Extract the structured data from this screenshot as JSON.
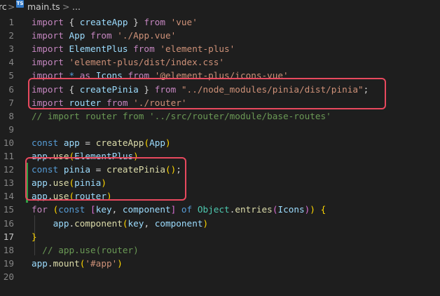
{
  "breadcrumb": {
    "prefix": "rc",
    "separator1": ">",
    "file_icon": "TS",
    "file": "main.ts",
    "separator2": ">",
    "more": "..."
  },
  "lines": [
    {
      "n": "1",
      "tokens": [
        [
          "k",
          "import"
        ],
        [
          "p",
          " { "
        ],
        [
          "v",
          "createApp"
        ],
        [
          "p",
          " } "
        ],
        [
          "k",
          "from"
        ],
        [
          "p",
          " "
        ],
        [
          "s",
          "'vue'"
        ]
      ]
    },
    {
      "n": "2",
      "tokens": [
        [
          "k",
          "import"
        ],
        [
          "p",
          " "
        ],
        [
          "v",
          "App"
        ],
        [
          "p",
          " "
        ],
        [
          "k",
          "from"
        ],
        [
          "p",
          " "
        ],
        [
          "s",
          "'./App.vue'"
        ]
      ]
    },
    {
      "n": "3",
      "tokens": [
        [
          "k",
          "import"
        ],
        [
          "p",
          " "
        ],
        [
          "v",
          "ElementPlus"
        ],
        [
          "p",
          " "
        ],
        [
          "k",
          "from"
        ],
        [
          "p",
          " "
        ],
        [
          "s",
          "'element-plus'"
        ]
      ]
    },
    {
      "n": "4",
      "tokens": [
        [
          "k",
          "import"
        ],
        [
          "p",
          " "
        ],
        [
          "s",
          "'element-plus/dist/index.css'"
        ]
      ]
    },
    {
      "n": "5",
      "tokens": [
        [
          "k",
          "import"
        ],
        [
          "p",
          " "
        ],
        [
          "kw",
          "*"
        ],
        [
          "p",
          " "
        ],
        [
          "k",
          "as"
        ],
        [
          "p",
          " "
        ],
        [
          "v",
          "Icons"
        ],
        [
          "p",
          " "
        ],
        [
          "k",
          "from"
        ],
        [
          "p",
          " "
        ],
        [
          "s",
          "'@element-plus/icons-vue'"
        ]
      ]
    },
    {
      "n": "6",
      "tokens": [
        [
          "k",
          "import"
        ],
        [
          "p",
          " { "
        ],
        [
          "v",
          "createPinia"
        ],
        [
          "p",
          " } "
        ],
        [
          "k",
          "from"
        ],
        [
          "p",
          " "
        ],
        [
          "s",
          "\"../node_modules/pinia/dist/pinia\""
        ],
        [
          "p",
          ";"
        ]
      ]
    },
    {
      "n": "7",
      "tokens": [
        [
          "k",
          "import"
        ],
        [
          "p",
          " "
        ],
        [
          "v",
          "router"
        ],
        [
          "p",
          " "
        ],
        [
          "k",
          "from"
        ],
        [
          "p",
          " "
        ],
        [
          "s",
          "'./router'"
        ]
      ]
    },
    {
      "n": "8",
      "tokens": [
        [
          "c",
          "// import router from '../src/router/module/base-routes'"
        ]
      ]
    },
    {
      "n": "9",
      "tokens": []
    },
    {
      "n": "10",
      "tokens": [
        [
          "kw",
          "const"
        ],
        [
          "p",
          " "
        ],
        [
          "v",
          "app"
        ],
        [
          "p",
          " = "
        ],
        [
          "fn",
          "createApp"
        ],
        [
          "bry",
          "("
        ],
        [
          "v",
          "App"
        ],
        [
          "bry",
          ")"
        ]
      ]
    },
    {
      "n": "11",
      "tokens": [
        [
          "v",
          "app"
        ],
        [
          "p",
          "."
        ],
        [
          "fn",
          "use"
        ],
        [
          "bry",
          "("
        ],
        [
          "v",
          "ElementPlus"
        ],
        [
          "bry",
          ")"
        ]
      ]
    },
    {
      "n": "12",
      "tokens": [
        [
          "kw",
          "const"
        ],
        [
          "p",
          " "
        ],
        [
          "v",
          "pinia"
        ],
        [
          "p",
          " = "
        ],
        [
          "fn",
          "createPinia"
        ],
        [
          "bry",
          "()"
        ],
        [
          "p",
          ";"
        ]
      ]
    },
    {
      "n": "13",
      "tokens": [
        [
          "v",
          "app"
        ],
        [
          "p",
          "."
        ],
        [
          "fn",
          "use"
        ],
        [
          "bry",
          "("
        ],
        [
          "v",
          "pinia"
        ],
        [
          "bry",
          ")"
        ]
      ]
    },
    {
      "n": "14",
      "tokens": [
        [
          "v",
          "app"
        ],
        [
          "p",
          "."
        ],
        [
          "fn",
          "use"
        ],
        [
          "bry",
          "("
        ],
        [
          "v",
          "router"
        ],
        [
          "bry",
          ")"
        ]
      ]
    },
    {
      "n": "15",
      "tokens": [
        [
          "k",
          "for"
        ],
        [
          "p",
          " "
        ],
        [
          "bry",
          "("
        ],
        [
          "kw",
          "const"
        ],
        [
          "p",
          " "
        ],
        [
          "brb",
          "["
        ],
        [
          "v",
          "key"
        ],
        [
          "p",
          ", "
        ],
        [
          "v",
          "component"
        ],
        [
          "brb",
          "]"
        ],
        [
          "p",
          " "
        ],
        [
          "kw",
          "of"
        ],
        [
          "p",
          " "
        ],
        [
          "t",
          "Object"
        ],
        [
          "p",
          "."
        ],
        [
          "fn",
          "entries"
        ],
        [
          "brb",
          "("
        ],
        [
          "v",
          "Icons"
        ],
        [
          "brb",
          ")"
        ],
        [
          "bry",
          ")"
        ],
        [
          "p",
          " "
        ],
        [
          "bry",
          "{"
        ]
      ]
    },
    {
      "n": "16",
      "tokens": [
        [
          "p",
          "    "
        ],
        [
          "v",
          "app"
        ],
        [
          "p",
          "."
        ],
        [
          "fn",
          "component"
        ],
        [
          "bry",
          "("
        ],
        [
          "v",
          "key"
        ],
        [
          "p",
          ", "
        ],
        [
          "v",
          "component"
        ],
        [
          "bry",
          ")"
        ]
      ]
    },
    {
      "n": "17",
      "tokens": [
        [
          "bry",
          "}"
        ]
      ]
    },
    {
      "n": "18",
      "tokens": [
        [
          "p",
          "  "
        ],
        [
          "c",
          "// app.use(router)"
        ]
      ]
    },
    {
      "n": "19",
      "tokens": [
        [
          "v",
          "app"
        ],
        [
          "p",
          "."
        ],
        [
          "fn",
          "mount"
        ],
        [
          "bry",
          "("
        ],
        [
          "s",
          "'#app'"
        ],
        [
          "bry",
          ")"
        ]
      ]
    },
    {
      "n": "20",
      "tokens": []
    }
  ],
  "active_line": "17",
  "modified_lines": [
    "12",
    "13",
    "14"
  ],
  "colors": {
    "background": "#1e1e1e",
    "highlight_box": "#e8495e",
    "git_modified": "#2ea043"
  }
}
